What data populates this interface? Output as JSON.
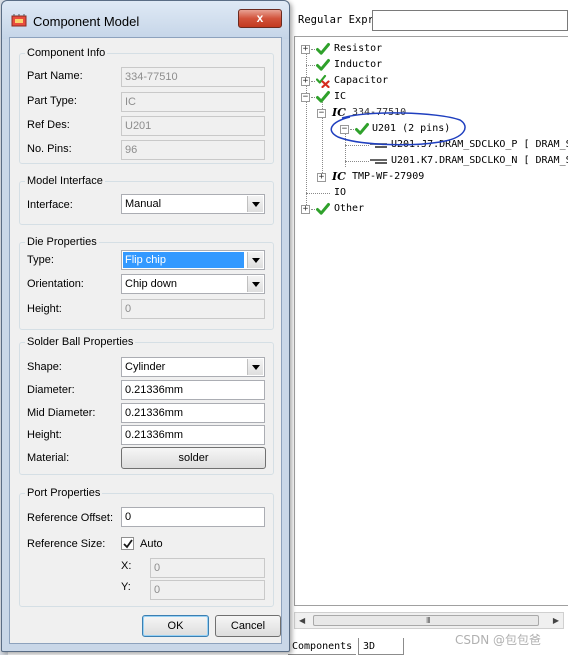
{
  "tree_panel": {
    "filter_label": "Regular Expr",
    "filter_value": "",
    "nodes": {
      "resistor": "Resistor",
      "inductor": "Inductor",
      "capacitor": "Capacitor",
      "ic": "IC",
      "ic_part": "334-77510",
      "u201": "U201  (2 pins)",
      "pin1": "U201.J7.DRAM_SDCLKO_P [ DRAM_S",
      "pin2": "U201.K7.DRAM_SDCLKO_N [ DRAM_S",
      "ic_part2": "TMP-WF-27909",
      "io": "IO",
      "other": "Other"
    },
    "ic_glyph": "IC",
    "scroll_grip": "III",
    "tabs": {
      "components": "Components",
      "three_d": "3D"
    },
    "watermark": "CSDN @包包爸",
    "icons": {
      "ok": "green-check-icon",
      "partial": "check-with-red-x-icon",
      "pin": "pin-trace-icon"
    },
    "colors": {
      "check_green": "#2fa12b",
      "error_red": "#d52b1e",
      "annotation_blue": "#1f3fbf"
    }
  },
  "dialog": {
    "title": "Component Model",
    "close_glyph": "x",
    "component_info": {
      "title": "Component Info",
      "part_name_label": "Part Name:",
      "part_name": "334-77510",
      "part_type_label": "Part Type:",
      "part_type": "IC",
      "ref_des_label": "Ref Des:",
      "ref_des": "U201",
      "no_pins_label": "No. Pins:",
      "no_pins": "96"
    },
    "model_interface": {
      "title": "Model Interface",
      "interface_label": "Interface:",
      "interface": "Manual"
    },
    "die_properties": {
      "title": "Die Properties",
      "type_label": "Type:",
      "type": "Flip chip",
      "orientation_label": "Orientation:",
      "orientation": "Chip down",
      "height_label": "Height:",
      "height": "0"
    },
    "solder_ball": {
      "title": "Solder Ball Properties",
      "shape_label": "Shape:",
      "shape": "Cylinder",
      "diameter_label": "Diameter:",
      "diameter": "0.21336mm",
      "mid_diameter_label": "Mid Diameter:",
      "mid_diameter": "0.21336mm",
      "height_label": "Height:",
      "height": "0.21336mm",
      "material_label": "Material:",
      "material": "solder"
    },
    "port_properties": {
      "title": "Port Properties",
      "ref_offset_label": "Reference Offset:",
      "ref_offset": "0",
      "ref_size_label": "Reference Size:",
      "auto_label": "Auto",
      "auto_checked": true,
      "x_label": "X:",
      "x": "0",
      "y_label": "Y:",
      "y": "0"
    },
    "buttons": {
      "ok": "OK",
      "cancel": "Cancel"
    }
  }
}
